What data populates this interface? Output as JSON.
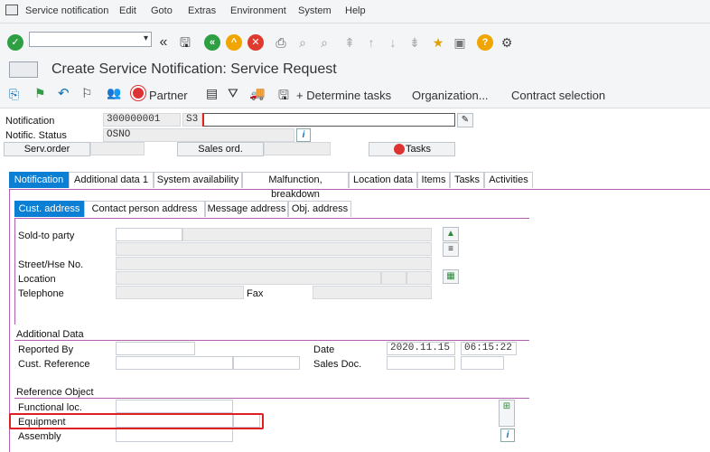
{
  "menu": [
    "Service notification",
    "Edit",
    "Goto",
    "Extras",
    "Environment",
    "System",
    "Help"
  ],
  "title": "Create Service Notification: Service Request",
  "app_toolbar": {
    "partner": "Partner",
    "determine_tasks": "+ Determine tasks",
    "organization": "Organization...",
    "contract_selection": "Contract selection"
  },
  "header": {
    "notification_label": "Notification",
    "notification_value": "300000001",
    "notification_type": "S3",
    "status_label": "Notific. Status",
    "status_value": "OSNO",
    "serv_order": "Serv.order",
    "sales_ord": "Sales ord.",
    "tasks": "Tasks"
  },
  "tabs": [
    "Notification",
    "Additional data 1",
    "System availability",
    "Malfunction, breakdown",
    "Location data",
    "Items",
    "Tasks",
    "Activities"
  ],
  "subtabs": [
    "Cust. address",
    "Contact person address",
    "Message address",
    "Obj. address"
  ],
  "address": {
    "sold_to": "Sold-to party",
    "street": "Street/Hse No.",
    "location": "Location",
    "telephone": "Telephone",
    "fax": "Fax"
  },
  "additional": {
    "title": "Additional Data",
    "reported_by": "Reported By",
    "cust_ref": "Cust. Reference",
    "date_label": "Date",
    "date_value": "2020.11.15",
    "time_value": "06:15:22",
    "sales_doc": "Sales Doc."
  },
  "reference": {
    "title": "Reference Object",
    "functional_loc": "Functional loc.",
    "equipment": "Equipment",
    "assembly": "Assembly"
  },
  "colors": {
    "accent": "#0a7fd4",
    "section_line": "#b060b0",
    "highlight": "#e02020"
  }
}
